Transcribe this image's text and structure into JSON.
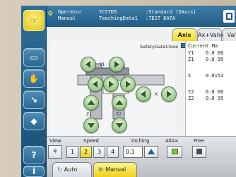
{
  "header": {
    "line1_left": "Operator",
    "line1_mid": "YCSTD5",
    "line1_right": ":Standard (5Axis)",
    "line2_left": "Manual",
    "line2_mid": "TeachingData1",
    "line2_right": ":TEST DATA"
  },
  "tabs": [
    "Axis",
    "Ax+Valve",
    "Valv"
  ],
  "panel": {
    "safety_label": "SafetyGateClose",
    "jog_labels": {
      "y1": "Y1",
      "x": "X",
      "z1": "Z1",
      "z2": "Z2"
    }
  },
  "data_table": {
    "header": "Current  Ma",
    "rows": [
      {
        "axis": "Y1",
        "value": "0.0 66"
      },
      {
        "axis": "Z1",
        "value": "0.0 95"
      },
      {
        "axis": "X",
        "value": "0.0153"
      },
      {
        "axis": "Y2",
        "value": "0.0 66"
      },
      {
        "axis": "Z2",
        "value": "0.0 95"
      }
    ]
  },
  "bottom": {
    "view_label": "View",
    "speed_label": "Speed",
    "speed_options": [
      "1",
      "2",
      "3",
      "4"
    ],
    "speed_selected": "2",
    "inching_label": "Inching",
    "inching_value": "0.1",
    "allax_label": "AllAx.",
    "free_label": "Free"
  },
  "footer": {
    "auto_label": "Auto",
    "manual_label": "Manual"
  },
  "colors": {
    "accent_yellow": "#f2dc1f",
    "header_blue": "#215c85",
    "jog_green": "#9bc38a"
  }
}
